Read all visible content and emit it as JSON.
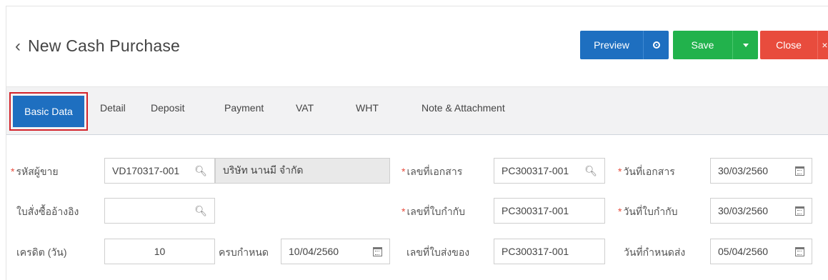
{
  "header": {
    "title": "New Cash Purchase",
    "preview_label": "Preview",
    "save_label": "Save",
    "close_label": "Close",
    "close_side": "×"
  },
  "tabs": [
    {
      "label": "Basic Data",
      "active": true
    },
    {
      "label": "Detail"
    },
    {
      "label": "Deposit"
    },
    {
      "label": "Payment"
    },
    {
      "label": "VAT"
    },
    {
      "label": "WHT"
    },
    {
      "label": "Note & Attachment"
    }
  ],
  "form": {
    "vendor_code": {
      "label": "รหัสผู้ขาย",
      "value": "VD170317-001",
      "name_value": "บริษัท นานมี จำกัด",
      "required": true
    },
    "po_ref": {
      "label": "ใบสั่งซื้ออ้างอิง",
      "value": ""
    },
    "credit": {
      "label": "เครดิต (วัน)",
      "value": "10"
    },
    "due": {
      "label": "ครบกำหนด",
      "value": "10/04/2560"
    },
    "doc_no": {
      "label": "เลขที่เอกสาร",
      "value": "PC300317-001",
      "required": true
    },
    "tax_no": {
      "label": "เลขที่ใบกำกับ",
      "value": "PC300317-001",
      "required": true
    },
    "delivery_no": {
      "label": "เลขที่ใบส่งของ",
      "value": "PC300317-001"
    },
    "doc_date": {
      "label": "วันที่เอกสาร",
      "value": "30/03/2560",
      "required": true
    },
    "tax_date": {
      "label": "วันที่ใบกำกับ",
      "value": "30/03/2560",
      "required": true
    },
    "delivery_date": {
      "label": "วันที่กำหนดส่ง",
      "value": "05/04/2560"
    }
  }
}
